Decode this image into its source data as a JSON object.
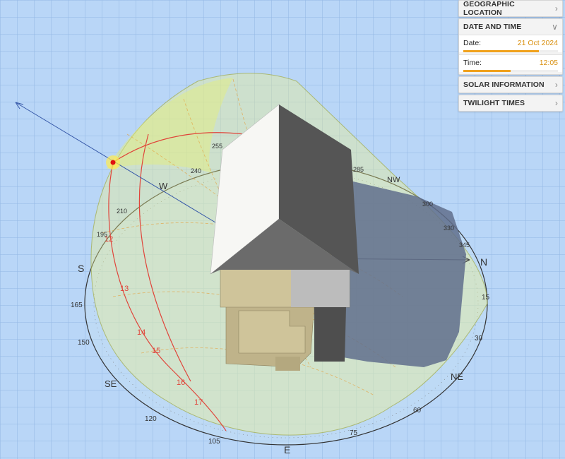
{
  "panel": {
    "sections": [
      {
        "title": "GEOGRAPHIC LOCATION",
        "expanded": false
      },
      {
        "title": "DATE AND TIME",
        "expanded": true
      },
      {
        "title": "SOLAR INFORMATION",
        "expanded": false
      },
      {
        "title": "TWILIGHT TIMES",
        "expanded": false
      }
    ],
    "date_label": "Date:",
    "date_value": "21 Oct 2024",
    "date_progress": 0.8,
    "time_label": "Time:",
    "time_value": "12:05",
    "time_progress": 0.5
  },
  "compass": {
    "north": "N",
    "south": "S",
    "east": "E",
    "west": "W",
    "northeast": "NE",
    "southeast": "SE",
    "northwest": "NW",
    "bearings": [
      "15",
      "30",
      "60",
      "75",
      "105",
      "120",
      "150",
      "165",
      "195",
      "210",
      "240",
      "255",
      "285",
      "300",
      "330",
      "345"
    ]
  },
  "hour_labels": [
    "12",
    "13",
    "14",
    "15",
    "16",
    "17"
  ],
  "colors": {
    "background": "#b9d6f7",
    "accent": "#f0a21e",
    "sun": "#e01010",
    "sun_path": "#e0443a",
    "dome_fill": "#eef28a",
    "shadow": "#6b7c98"
  }
}
